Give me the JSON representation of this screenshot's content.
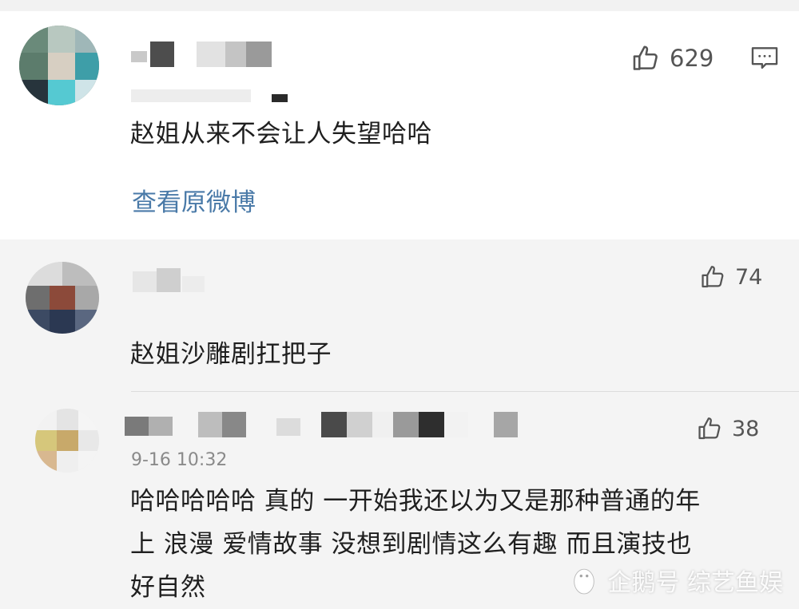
{
  "main_comment": {
    "likes": "629",
    "text": "赵姐从来不会让人失望哈哈",
    "view_original_link": "查看原微博"
  },
  "replies": [
    {
      "likes": "74",
      "text": "赵姐沙雕剧扛把子"
    },
    {
      "likes": "38",
      "time": "9-16 10:32",
      "text_lines": [
        "哈哈哈哈哈 真的 一开始我还以为又是那种普通的年",
        "上 浪漫 爱情故事 没想到剧情这么有趣 而且演技也",
        "好自然"
      ]
    }
  ],
  "watermark": {
    "text": "企鹅号 综艺鱼娱"
  },
  "icons": {
    "like": "thumbs-up-icon",
    "comment": "comment-icon",
    "watermark_logo": "penguin-logo-icon"
  },
  "colors": {
    "link": "#4a7aa8",
    "text": "#1f1f1f",
    "muted": "#8a8a8a",
    "icon": "#555555"
  }
}
